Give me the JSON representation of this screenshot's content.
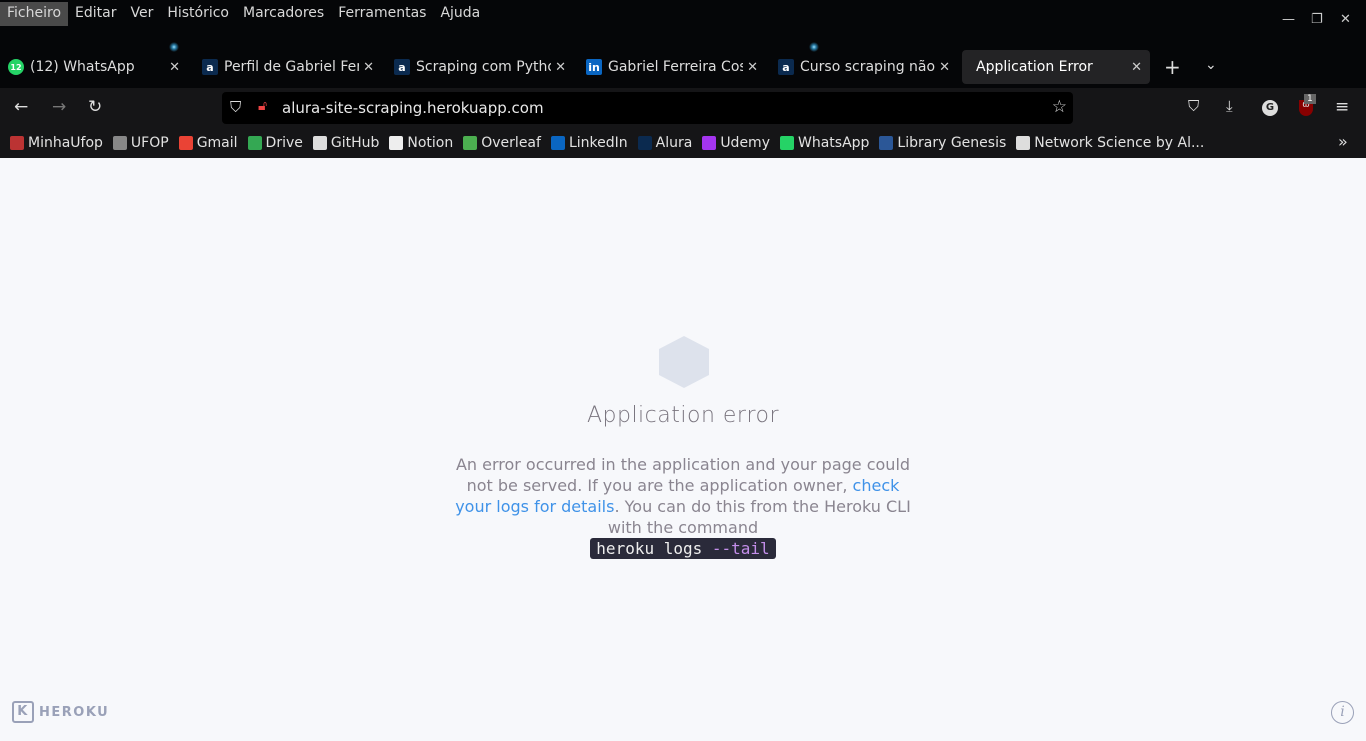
{
  "menu": [
    "Ficheiro",
    "Editar",
    "Ver",
    "Histórico",
    "Marcadores",
    "Ferramentas",
    "Ajuda"
  ],
  "tabs": [
    {
      "title": "(12) WhatsApp",
      "icon": "whatsapp-icon",
      "badge": "12",
      "color": "#25d366"
    },
    {
      "title": "Perfil de Gabriel Ferreira",
      "icon": "alura-icon",
      "badge": "a",
      "color": "#0b2a4f"
    },
    {
      "title": "Scraping com Python",
      "icon": "alura-icon",
      "badge": "a",
      "color": "#0b2a4f"
    },
    {
      "title": "Gabriel Ferreira Costa",
      "icon": "linkedin-icon",
      "badge": "in",
      "color": "#0a66c2"
    },
    {
      "title": "Curso scraping não é",
      "icon": "alura-icon",
      "badge": "a",
      "color": "#0b2a4f"
    },
    {
      "title": "Application Error",
      "active": true
    }
  ],
  "url": "alura-site-scraping.herokuapp.com",
  "extension_badge": "1",
  "bookmarks": [
    {
      "label": "MinhaUfop",
      "icon": "minhaufop-icon",
      "color": "#b33"
    },
    {
      "label": "UFOP",
      "icon": "ufop-icon",
      "color": "#888"
    },
    {
      "label": "Gmail",
      "icon": "gmail-icon",
      "color": "#ea4335"
    },
    {
      "label": "Drive",
      "icon": "drive-icon",
      "color": "#34a853"
    },
    {
      "label": "GitHub",
      "icon": "github-icon",
      "color": "#ddd"
    },
    {
      "label": "Notion",
      "icon": "notion-icon",
      "color": "#eee"
    },
    {
      "label": "Overleaf",
      "icon": "overleaf-icon",
      "color": "#4caf50"
    },
    {
      "label": "LinkedIn",
      "icon": "linkedin-icon",
      "color": "#0a66c2"
    },
    {
      "label": "Alura",
      "icon": "alura-icon",
      "color": "#0b2a4f"
    },
    {
      "label": "Udemy",
      "icon": "udemy-icon",
      "color": "#a435f0"
    },
    {
      "label": "WhatsApp",
      "icon": "whatsapp-icon",
      "color": "#25d366"
    },
    {
      "label": "Library Genesis",
      "icon": "libgen-icon",
      "color": "#2b5797"
    },
    {
      "label": "Network Science by Al...",
      "icon": "globe-icon",
      "color": "#ddd"
    }
  ],
  "page": {
    "title": "Application error",
    "msg1": "An error occurred in the application and your page could not be served. If you are the application owner, ",
    "link": "check your logs for details",
    "msg2": ". You can do this from the Heroku CLI with the command",
    "cmd": "heroku logs ",
    "cmd_flag": "--tail",
    "brand": "HEROKU"
  }
}
